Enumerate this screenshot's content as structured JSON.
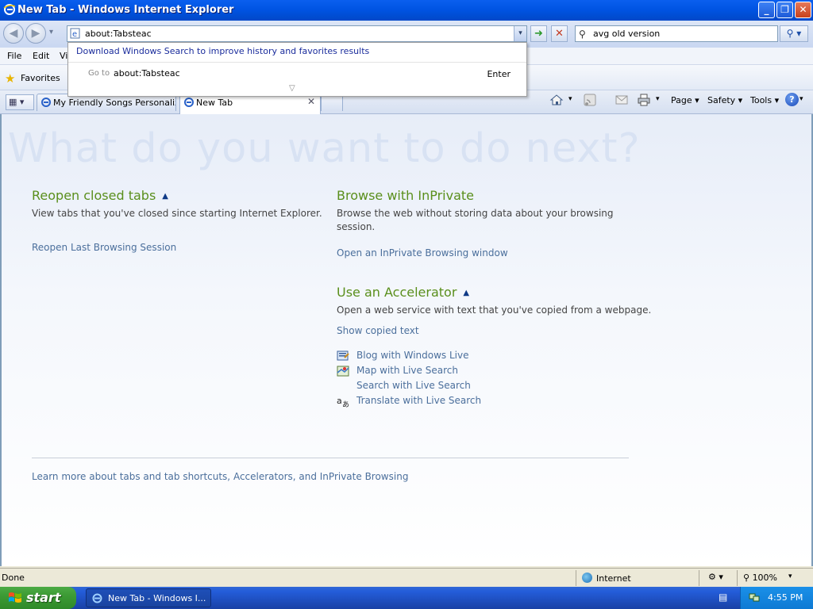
{
  "window": {
    "title": "New Tab - Windows Internet Explorer",
    "min_glyph": "_",
    "max_glyph": "❐",
    "close_glyph": "✕"
  },
  "nav": {
    "back_glyph": "◀",
    "forward_glyph": "▶",
    "dropdown_glyph": "▾"
  },
  "address": {
    "value": "about:Tabsteac",
    "go_glyph": "➜",
    "stop_glyph": "✕"
  },
  "search": {
    "value": "avg old version",
    "placeholder": "",
    "button_glyph": "⚲ ▾"
  },
  "autocomplete": {
    "header": "Download Windows Search to improve history and favorites results",
    "goto_label": "Go to",
    "goto_value": "about:Tabsteac",
    "enter_label": "Enter",
    "expand_glyph": "▽"
  },
  "menu": {
    "items": [
      "File",
      "Edit",
      "Vi"
    ]
  },
  "favorites": {
    "label": "Favorites"
  },
  "tabs": {
    "items": [
      {
        "label": "My Friendly Songs Personaliz...",
        "active": false
      },
      {
        "label": "New Tab",
        "active": true
      }
    ],
    "close_glyph": "✕"
  },
  "commandbar": {
    "page": "Page ▾",
    "safety": "Safety ▾",
    "tools": "Tools ▾",
    "help": "?"
  },
  "content": {
    "hero": "What do you want to do next?",
    "reopen": {
      "title": "Reopen closed tabs",
      "desc": "View tabs that you've closed since starting Internet Explorer.",
      "link": "Reopen Last Browsing Session"
    },
    "inprivate": {
      "title": "Browse with InPrivate",
      "desc": "Browse the web without storing data about your browsing session.",
      "link": "Open an InPrivate Browsing window"
    },
    "accelerator": {
      "title": "Use an Accelerator",
      "desc": "Open a web service with text that you've copied from a webpage.",
      "link": "Show copied text",
      "items": [
        {
          "label": "Blog with Windows Live",
          "icon": "blog-icon"
        },
        {
          "label": "Map with Live Search",
          "icon": "map-icon"
        },
        {
          "label": "Search with Live Search",
          "icon": ""
        },
        {
          "label": "Translate with Live Search",
          "icon": "translate-icon"
        }
      ]
    },
    "learn_more": "Learn more about tabs and tab shortcuts, Accelerators, and InPrivate Browsing"
  },
  "status": {
    "text": "Done",
    "zone": "Internet",
    "zoom": "100%"
  },
  "taskbar": {
    "start": "start",
    "item": "New Tab - Windows I...",
    "clock": "4:55 PM"
  },
  "colors": {
    "accent_green": "#5A8F1C",
    "link_blue": "#4B6F9C",
    "titlebar_blue": "#0054E3",
    "start_green": "#3C9A34"
  }
}
